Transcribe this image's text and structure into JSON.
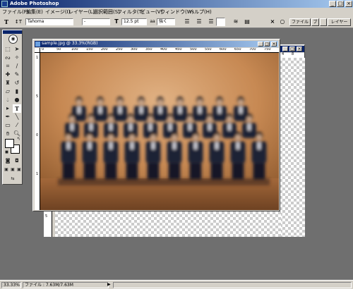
{
  "app": {
    "title": "Adobe Photoshop"
  },
  "window_buttons": {
    "minimize": "_",
    "maximize": "□",
    "close": "×"
  },
  "menu": [
    "ファイル(F)",
    "編集(E)",
    "イメージ(I)",
    "レイヤー(L)",
    "選択範囲(S)",
    "フィルタ(T)",
    "ビュー(V)",
    "ウィンドウ(W)",
    "ヘルプ(H)"
  ],
  "options": {
    "font_family": "Tahoma",
    "font_style": "-",
    "font_size": "12.5 pt",
    "antialias_label": "aa",
    "antialias": "強く",
    "cancel_icon": "×",
    "commit_icon": "○",
    "palette_buttons": [
      "ファイル",
      "ブ",
      "",
      "レイヤー"
    ]
  },
  "document": {
    "title": "sample.jpg @ 33.3%(RGB)",
    "ruler_top_labels": [
      "0",
      "50",
      "100",
      "150",
      "200",
      "250",
      "300",
      "350",
      "400",
      "450",
      "500",
      "550",
      "600",
      "650",
      "700",
      "750",
      "800"
    ],
    "ruler_left_labels": [
      "1",
      "5",
      "0",
      "1"
    ],
    "image_alt": "blurred group photo"
  },
  "document2": {
    "ruler_labels": [
      "4",
      "8",
      "5"
    ]
  },
  "status": {
    "zoom": "33.33%",
    "file_size": "ファイル : 7.63M/7.63M",
    "arrow": "▶"
  },
  "colors": {
    "title_bar": "#0a246a",
    "chrome": "#d4d0c8",
    "workspace": "#6f6f6f"
  }
}
